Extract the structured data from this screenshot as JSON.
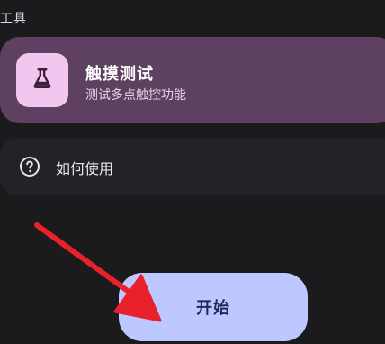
{
  "section": {
    "label": "工具"
  },
  "tool_card": {
    "title": "触摸测试",
    "subtitle": "测试多点触控功能",
    "icon": "flask-icon"
  },
  "howto": {
    "label": "如何使用",
    "icon": "help-circle-icon"
  },
  "start_button": {
    "label": "开始"
  },
  "annotation": {
    "icon": "red-arrow-pointer"
  },
  "colors": {
    "background": "#1b1a1d",
    "card": "#5e4160",
    "icon_tile": "#f3c6ef",
    "button": "#bcc8ff",
    "arrow": "#e8212a"
  }
}
